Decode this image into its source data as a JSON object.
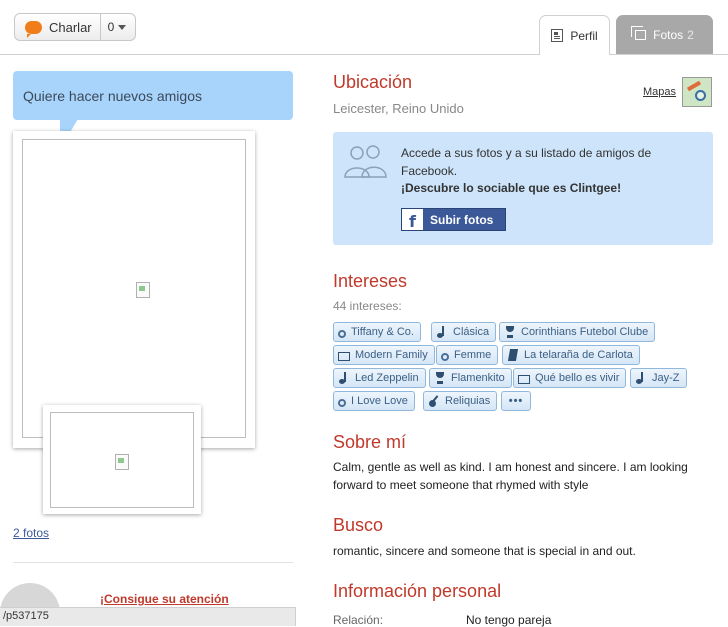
{
  "topbar": {
    "chat_label": "Charlar",
    "chat_count": "0",
    "tabs": [
      {
        "label": "Perfil",
        "icon": "profile-doc-icon"
      },
      {
        "label": "Fotos",
        "count": "2",
        "icon": "photos-icon"
      }
    ]
  },
  "left": {
    "speech": "Quiere hacer nuevos amigos",
    "photos_link": "2 fotos",
    "promo_link": "¡Consigue su atención",
    "status_url": "/p537175"
  },
  "location": {
    "title": "Ubicación",
    "value": "Leicester, Reino Unido",
    "maps_label": "Mapas"
  },
  "facebook": {
    "line1": "Accede a sus fotos y a su listado de amigos de Facebook.",
    "line2": "¡Descubre lo sociable que es Clintgee!",
    "button": "Subir fotos"
  },
  "interests": {
    "title": "Intereses",
    "count_label": "44 intereses:",
    "tags": [
      {
        "label": "Tiffany & Co.",
        "icon": "ring"
      },
      {
        "label": "Clásica",
        "icon": "note"
      },
      {
        "label": "Corinthians Futebol Clube",
        "icon": "trophy"
      },
      {
        "label": "Modern Family",
        "icon": "tv"
      },
      {
        "label": "Femme",
        "icon": "ring"
      },
      {
        "label": "La telaraña de Carlota",
        "icon": "book"
      },
      {
        "label": "Led Zeppelin",
        "icon": "note"
      },
      {
        "label": "Flamenkito",
        "icon": "trophy"
      },
      {
        "label": "Qué bello es vivir",
        "icon": "tv"
      },
      {
        "label": "Jay-Z",
        "icon": "note"
      },
      {
        "label": "I Love Love",
        "icon": "ring"
      },
      {
        "label": "Reliquias",
        "icon": "guitar"
      }
    ],
    "more_label": "•••"
  },
  "about": {
    "title": "Sobre mí",
    "text": "Calm, gentle as well as kind. I am honest and sincere. I am looking forward to meet someone that rhymed with style"
  },
  "seeking": {
    "title": "Busco",
    "text": "romantic, sincere and someone that is special in and out."
  },
  "personal": {
    "title": "Información personal",
    "rows": [
      {
        "label": "Relación:",
        "value": "No tengo pareja"
      }
    ]
  }
}
